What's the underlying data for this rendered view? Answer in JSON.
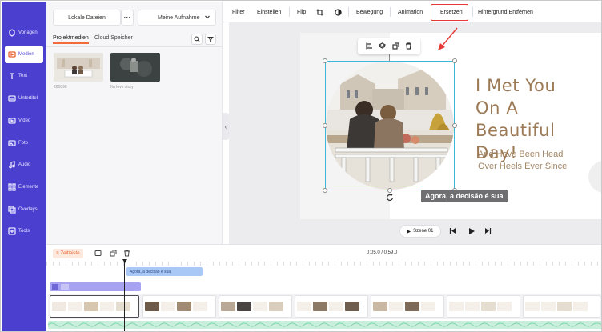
{
  "nav": {
    "items": [
      {
        "label": "Vorlagen",
        "icon": "templates-icon"
      },
      {
        "label": "Medien",
        "icon": "media-icon",
        "active": true
      },
      {
        "label": "Text",
        "icon": "text-icon"
      },
      {
        "label": "Untertitel",
        "icon": "subtitles-icon"
      },
      {
        "label": "Video",
        "icon": "video-icon"
      },
      {
        "label": "Foto",
        "icon": "photo-icon"
      },
      {
        "label": "Audio",
        "icon": "audio-icon"
      },
      {
        "label": "Elemente",
        "icon": "elements-icon"
      },
      {
        "label": "Overlays",
        "icon": "overlays-icon"
      },
      {
        "label": "Tools",
        "icon": "tools-icon"
      }
    ],
    "bg": "#4b3fd0"
  },
  "media": {
    "local_files": "Lokale Dateien",
    "more": "···",
    "recording": "Meine Aufnahme",
    "tabs": [
      "Projektmedien",
      "Cloud Speicher"
    ],
    "thumbs": [
      {
        "label": "280898"
      },
      {
        "label": "IIA love story"
      }
    ]
  },
  "toolbar": {
    "filter": "Filter",
    "einstellen": "Einstellen",
    "flip": "Flip",
    "bewegung": "Bewegung",
    "animation": "Animation",
    "ersetzen": "Ersetzen",
    "hintergrund": "Hintergrund Entfernen"
  },
  "slide": {
    "title_lines": [
      "I Met You",
      "On A",
      "Beautiful Day!"
    ],
    "sub_lines": [
      "And Have Been Head",
      "Over Heels Ever Since"
    ],
    "caption": "Agora, a decisão é sua",
    "text_color": "#9c7a55"
  },
  "player": {
    "scene": "Szene 01"
  },
  "timeline": {
    "label": "Zeitleiste",
    "time": "0:05.0 / 0:59.0",
    "subtitle_clip": "Agora, a decisão é sua",
    "accent": "#e8622e"
  }
}
